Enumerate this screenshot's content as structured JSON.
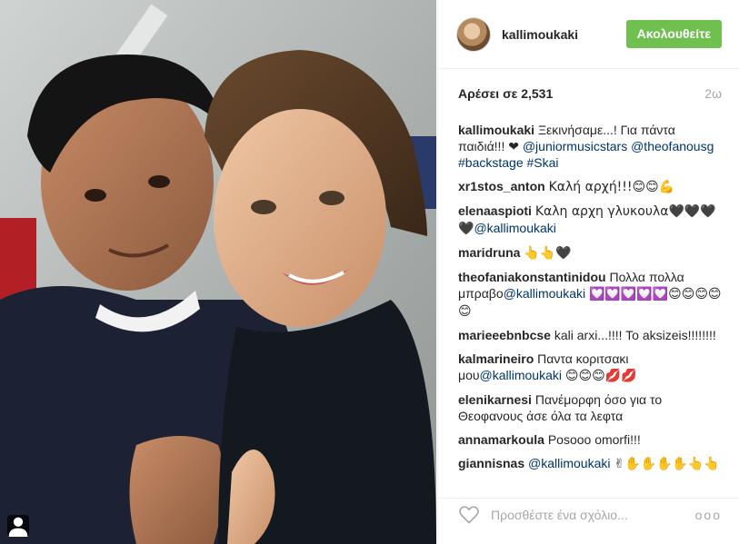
{
  "post": {
    "username": "kallimoukaki",
    "follow_label": "Ακολουθείτε",
    "likes": "Αρέσει σε 2,531",
    "time": "2ω"
  },
  "caption": {
    "user": "kallimoukaki",
    "text": "Ξεκινήσαμε...! Για πάντα παιδιά!!! ❤",
    "mention": "@juniormusicstars",
    "tags": "@theofanousg #backstage #Skai"
  },
  "comments": [
    {
      "user": "xr1stos_anton",
      "text": "Καλή αρχή!!!😊😊💪"
    },
    {
      "user": "elenaaspioti",
      "text": "Καλη αρχη γλυκουλα🖤🖤🖤🖤",
      "mention": "@kallimoukaki"
    },
    {
      "user": "maridruna",
      "text": "👆👆🖤"
    },
    {
      "user": "theofaniakonstantinidou",
      "text": "Πολλα πολλα μπραβο",
      "mention": "@kallimoukaki",
      "after": "💟💟💟💟💟😊😊😊😊😊"
    },
    {
      "user": "marieeebnbcse",
      "text": "kali arxi...!!!! To aksizeis!!!!!!!!"
    },
    {
      "user": "kalmarineiro",
      "text": "Παντα κοριτσακι μου",
      "mention": "@kallimoukaki",
      "after": "😊😊😊💋💋"
    },
    {
      "user": "elenikarnesi",
      "text": "Πανέμορφη όσο για το Θεοφανους άσε όλα τα λεφτα"
    },
    {
      "user": "annamarkoula",
      "text": "Posooo omorfi!!!"
    },
    {
      "user": "giannisnas",
      "text": "",
      "mention": "@kallimoukaki",
      "after": "✌✋✋✋✋👆👆"
    }
  ],
  "footer": {
    "placeholder": "Προσθέστε ένα σχόλιο...",
    "more": "ooo"
  },
  "icons": {
    "heart": "heart-icon",
    "user_tag": "user-tag-icon"
  },
  "colors": {
    "follow_button": "#70c050",
    "link": "#003569",
    "muted": "#a5a7aa"
  }
}
